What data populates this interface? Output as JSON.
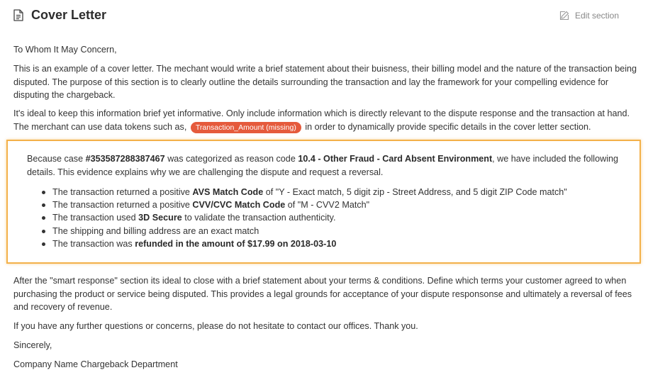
{
  "header": {
    "title": "Cover Letter",
    "edit_label": "Edit section"
  },
  "letter": {
    "greeting": "To Whom It May Concern,",
    "para1": "This is an example of a cover letter. The mechant would write a brief statement about their buisness, their billing model and the nature of the transaction being disputed. The purpose of this section is to clearly outline the details surrounding the transaction and lay the framework for your compelling evidence for disputing the chargeback.",
    "para2_before": "It's ideal to keep this information brief yet informative. Only include information which is directly relevant to the dispute response and the transaction at hand. The merchant can use data tokens such as,",
    "token_label": "Transaction_Amount (missing)",
    "para2_after": "in order to dynamically provide specific details in the cover letter section.",
    "para3": "After the \"smart response\" section its ideal to close with a brief statement about your terms & conditions. Define which terms your customer agreed to when purchasing the product or service being disputed. This provides a legal grounds for acceptance of your dispute responsonse and ultimately a reversal of fees and recovery of revenue.",
    "para4": "If you have any further questions or concerns, please do not hesitate to contact our offices. Thank you.",
    "closing": "Sincerely,",
    "signature": "Company Name Chargeback Department"
  },
  "smart_response": {
    "intro_1": "Because case ",
    "case_number": "#353587288387467",
    "intro_2": " was categorized as reason code ",
    "reason_code": "10.4 - Other Fraud - Card Absent Environment",
    "intro_3": ", we have included the following details. This evidence explains why we are challenging the dispute and request a reversal.",
    "items": [
      {
        "pre": "The transaction returned a positive ",
        "bold": "AVS Match Code",
        "post": " of \"Y - Exact match, 5 digit zip - Street Address, and 5 digit ZIP Code match\""
      },
      {
        "pre": "The transaction returned a positive ",
        "bold": "CVV/CVC Match Code",
        "post": " of \"M - CVV2 Match\""
      },
      {
        "pre": "The transaction used ",
        "bold": "3D Secure",
        "post": " to validate the transaction authenticity."
      },
      {
        "pre": "The shipping and billing address are an exact match",
        "bold": "",
        "post": ""
      },
      {
        "pre": "The transaction was ",
        "bold": "refunded in the amount of $17.99 on 2018-03-10",
        "post": ""
      }
    ]
  },
  "colors": {
    "token_bg": "#e55a3c",
    "highlight_border": "#f3b14a"
  }
}
